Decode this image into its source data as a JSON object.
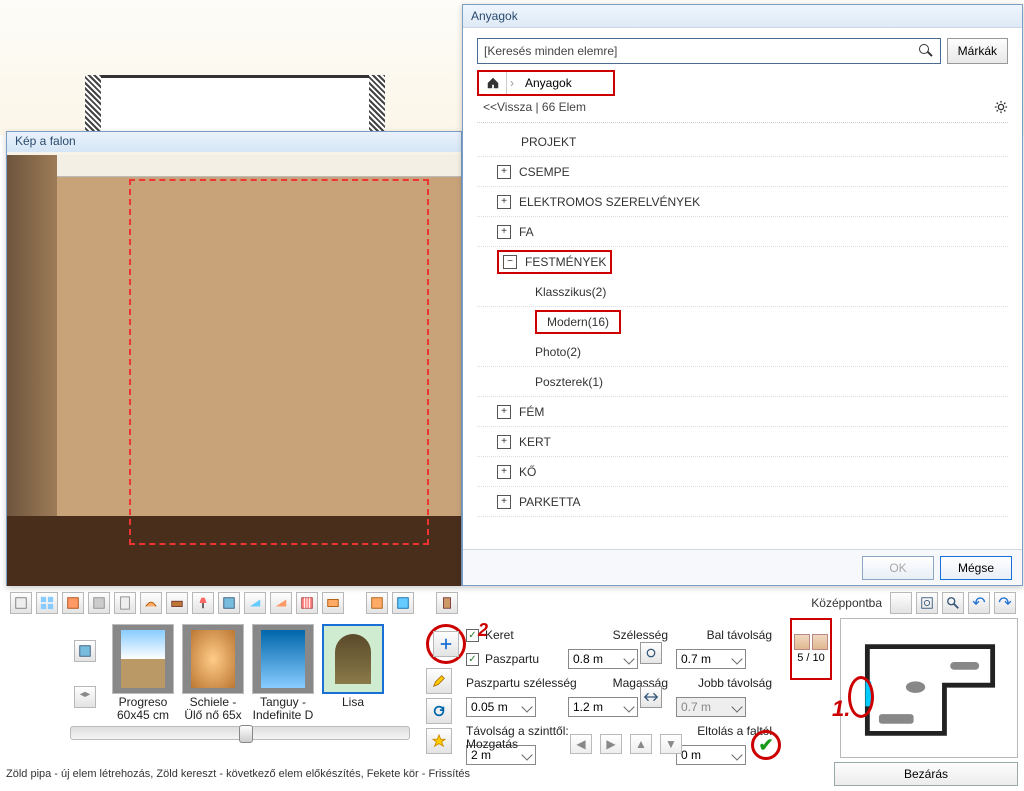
{
  "windows": {
    "preview_title": "Kép a falon",
    "materials_title": "Anyagok"
  },
  "search": {
    "placeholder": "[Keresés minden elemre]",
    "brands_btn": "Márkák"
  },
  "breadcrumb": {
    "label": "Anyagok"
  },
  "back_row": "<<Vissza   |  66 Elem",
  "tree": {
    "project": "PROJEKT",
    "csempe": "CSEMPE",
    "elektromos": "ELEKTROMOS SZERELVÉNYEK",
    "fa": "FA",
    "festmenyek": "FESTMÉNYEK",
    "klasszikus": "Klasszikus(2)",
    "modern": "Modern(16)",
    "photo": "Photo(2)",
    "poszterek": "Poszterek(1)",
    "fem": "FÉM",
    "kert": "KERT",
    "ko": "KŐ",
    "parketta": "PARKETTA"
  },
  "buttons": {
    "ok": "OK",
    "cancel": "Mégse",
    "close": "Bezárás"
  },
  "toolbar_label": "Középpontba",
  "thumbs": [
    {
      "name": "Progreso",
      "sub": "60x45 cm"
    },
    {
      "name": "Schiele -",
      "sub": "Ülő nő 65x"
    },
    {
      "name": "Tanguy -",
      "sub": "Indefinite D"
    },
    {
      "name": "Lisa",
      "sub": ""
    }
  ],
  "fields": {
    "keret": "Keret",
    "paszpartu": "Paszpartu",
    "paszpartu_szelesseg": "Paszpartu szélesség",
    "paszpartu_szelesseg_val": "0.05 m",
    "tavolsag": "Távolság a szinttől:",
    "tavolsag_val": "2 m",
    "szelesseg": "Szélesség",
    "szelesseg_val": "0.8 m",
    "magassag": "Magasság",
    "magassag_val": "1.2 m",
    "mozgatas": "Mozgatás",
    "bal": "Bal távolság",
    "bal_val": "0.7 m",
    "jobb": "Jobb távolság",
    "jobb_val": "0.7 m",
    "eltolas": "Eltolás a faltól",
    "eltolas_val": "0 m"
  },
  "stamp": "5 / 10",
  "status_text": "Zöld pipa - új elem létrehozás, Zöld kereszt - következő elem előkészítés, Fekete kör - Frissítés",
  "marker1": "1.",
  "marker2": "2"
}
